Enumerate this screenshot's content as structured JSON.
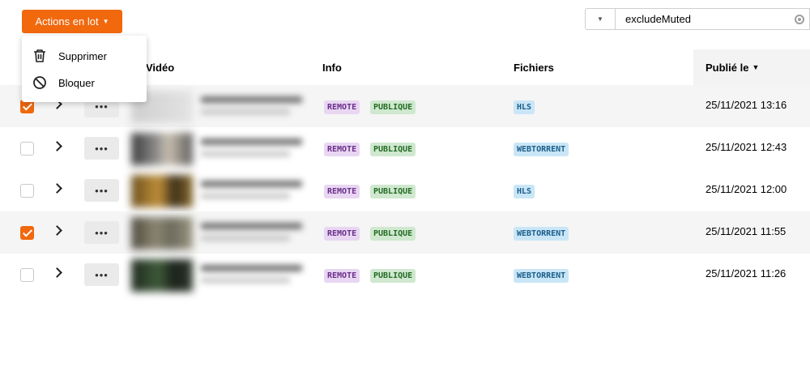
{
  "toolbar": {
    "bulk_actions_label": "Actions en lot",
    "filter_value": "excludeMuted"
  },
  "menu": {
    "items": [
      {
        "label": "Supprimer",
        "icon": "trash-icon"
      },
      {
        "label": "Bloquer",
        "icon": "block-icon"
      }
    ]
  },
  "table": {
    "columns": {
      "video": "Vidéo",
      "info": "Info",
      "files": "Fichiers",
      "published": "Publié le"
    },
    "rows": [
      {
        "checked": true,
        "info_tags": [
          "REMOTE",
          "PUBLIQUE"
        ],
        "files_tag": "HLS",
        "published": "25/11/2021 13:16"
      },
      {
        "checked": false,
        "info_tags": [
          "REMOTE",
          "PUBLIQUE"
        ],
        "files_tag": "WEBTORRENT",
        "published": "25/11/2021 12:43"
      },
      {
        "checked": false,
        "info_tags": [
          "REMOTE",
          "PUBLIQUE"
        ],
        "files_tag": "HLS",
        "published": "25/11/2021 12:00"
      },
      {
        "checked": true,
        "info_tags": [
          "REMOTE",
          "PUBLIQUE"
        ],
        "files_tag": "WEBTORRENT",
        "published": "25/11/2021 11:55"
      },
      {
        "checked": false,
        "info_tags": [
          "REMOTE",
          "PUBLIQUE"
        ],
        "files_tag": "WEBTORRENT",
        "published": "25/11/2021 11:26"
      }
    ]
  },
  "colors": {
    "accent": "#f1680d",
    "tag_remote_bg": "#e8d6f2",
    "tag_public_bg": "#cfe8cf",
    "tag_file_bg": "#c9e6f7"
  }
}
